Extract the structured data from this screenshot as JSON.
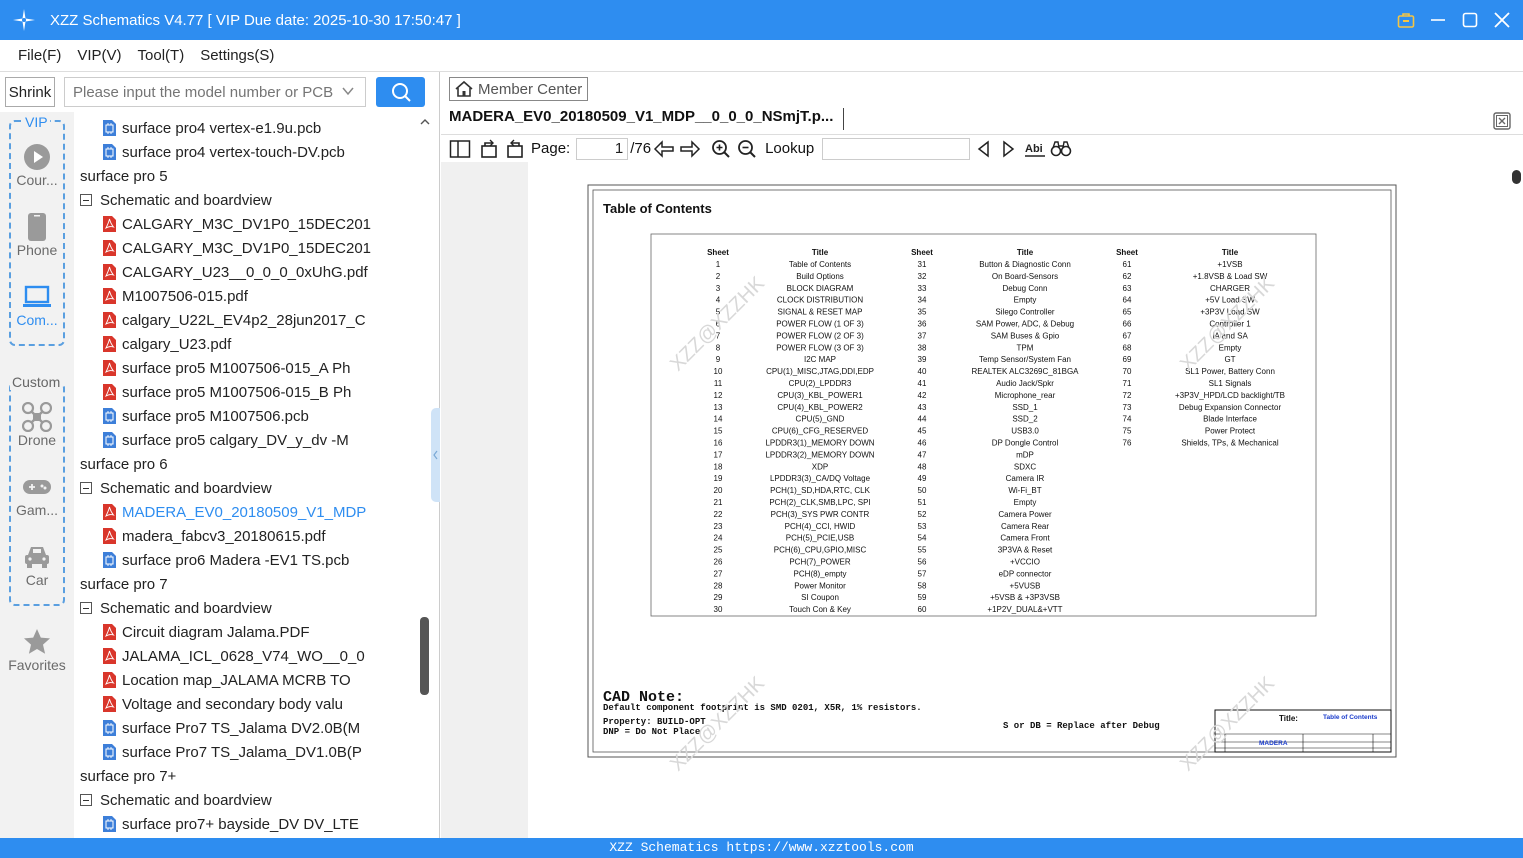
{
  "window": {
    "title": "XZZ Schematics V4.77 [ VIP Due date: 2025-10-30 17:50:47 ]"
  },
  "menu": [
    "File(F)",
    "VIP(V)",
    "Tool(T)",
    "Settings(S)"
  ],
  "toolbar": {
    "shrink": "Shrink",
    "search_placeholder": "Please input the model number or PCB"
  },
  "sidebar": {
    "vip_label": "VIP",
    "custom_label": "Custom",
    "items": [
      {
        "label": "Cour...",
        "icon": "play-icon"
      },
      {
        "label": "Phone",
        "icon": "phone-icon"
      },
      {
        "label": "Com...",
        "icon": "laptop-icon",
        "active": true
      },
      {
        "label": "Drone",
        "icon": "drone-icon"
      },
      {
        "label": "Gam...",
        "icon": "gamepad-icon"
      },
      {
        "label": "Car",
        "icon": "car-icon"
      },
      {
        "label": "Favorites",
        "icon": "star-icon"
      }
    ]
  },
  "tree": [
    {
      "level": 2,
      "type": "pcb",
      "label": "surface pro4 vertex-e1.9u.pcb"
    },
    {
      "level": 2,
      "type": "pcb",
      "label": "surface pro4 vertex-touch-DV.pcb"
    },
    {
      "level": 0,
      "type": "folder",
      "label": "surface pro 5"
    },
    {
      "level": 1,
      "type": "folder",
      "label": "Schematic and boardview"
    },
    {
      "level": 2,
      "type": "pdf",
      "label": "CALGARY_M3C_DV1P0_15DEC201"
    },
    {
      "level": 2,
      "type": "pdf",
      "label": "CALGARY_M3C_DV1P0_15DEC201"
    },
    {
      "level": 2,
      "type": "pdf",
      "label": "CALGARY_U23__0_0_0_0xUhG.pdf"
    },
    {
      "level": 2,
      "type": "pdf",
      "label": "M1007506-015.pdf"
    },
    {
      "level": 2,
      "type": "pdf",
      "label": "calgary_U22L_EV4p2_28jun2017_C"
    },
    {
      "level": 2,
      "type": "pdf",
      "label": "calgary_U23.pdf"
    },
    {
      "level": 2,
      "type": "pdf",
      "label": "surface pro5 M1007506-015_A Ph"
    },
    {
      "level": 2,
      "type": "pdf",
      "label": "surface pro5 M1007506-015_B Ph"
    },
    {
      "level": 2,
      "type": "pcb",
      "label": "surface pro5 M1007506.pcb"
    },
    {
      "level": 2,
      "type": "pcb",
      "label": "surface pro5 calgary_DV_y_dv -M"
    },
    {
      "level": 0,
      "type": "folder",
      "label": "surface pro 6"
    },
    {
      "level": 1,
      "type": "folder",
      "label": "Schematic and boardview"
    },
    {
      "level": 2,
      "type": "pdf",
      "label": "MADERA_EV0_20180509_V1_MDP",
      "selected": true
    },
    {
      "level": 2,
      "type": "pdf",
      "label": "madera_fabcv3_20180615.pdf"
    },
    {
      "level": 2,
      "type": "pcb",
      "label": "surface pro6 Madera -EV1 TS.pcb"
    },
    {
      "level": 0,
      "type": "folder",
      "label": "surface pro 7"
    },
    {
      "level": 1,
      "type": "folder",
      "label": "Schematic and boardview"
    },
    {
      "level": 2,
      "type": "pdf",
      "label": "Circuit diagram Jalama.PDF"
    },
    {
      "level": 2,
      "type": "pdf",
      "label": "JALAMA_ICL_0628_V74_WO__0_0"
    },
    {
      "level": 2,
      "type": "pdf",
      "label": "Location map_JALAMA MCRB TO"
    },
    {
      "level": 2,
      "type": "pdf",
      "label": "Voltage and secondary body valu"
    },
    {
      "level": 2,
      "type": "pcb",
      "label": "surface Pro7 TS_Jalama DV2.0B(M"
    },
    {
      "level": 2,
      "type": "pcb",
      "label": "surface Pro7 TS_Jalama_DV1.0B(P"
    },
    {
      "level": 0,
      "type": "folder",
      "label": "surface pro 7+"
    },
    {
      "level": 1,
      "type": "folder",
      "label": "Schematic and boardview"
    },
    {
      "level": 2,
      "type": "pcb",
      "label": "surface pro7+ bayside_DV DV_LTE"
    }
  ],
  "viewer": {
    "member_center": "Member Center",
    "doc_title": "MADERA_EV0_20180509_V1_MDP__0_0_0_NSmjT.p...",
    "page_label": "Page:",
    "page_current": "1",
    "page_total": "/76",
    "lookup_label": "Lookup"
  },
  "document": {
    "heading": "Table of Contents",
    "col_headers": {
      "sheet": "Sheet",
      "title": "Title"
    },
    "col1": [
      [
        "1",
        "Table of Contents"
      ],
      [
        "2",
        "Build Options"
      ],
      [
        "3",
        "BLOCK DIAGRAM"
      ],
      [
        "4",
        "CLOCK DISTRIBUTION"
      ],
      [
        "5",
        "SIGNAL & RESET MAP"
      ],
      [
        "6",
        "POWER FLOW (1 OF 3)"
      ],
      [
        "7",
        "POWER FLOW (2 OF 3)"
      ],
      [
        "8",
        "POWER FLOW (3 OF 3)"
      ],
      [
        "9",
        "I2C MAP"
      ],
      [
        "10",
        "CPU(1)_MISC,JTAG,DDI,EDP"
      ],
      [
        "11",
        "CPU(2)_LPDDR3"
      ],
      [
        "12",
        "CPU(3)_KBL_POWER1"
      ],
      [
        "13",
        "CPU(4)_KBL_POWER2"
      ],
      [
        "14",
        "CPU(5)_GND"
      ],
      [
        "15",
        "CPU(6)_CFG_RESERVED"
      ],
      [
        "16",
        "LPDDR3(1)_MEMORY DOWN"
      ],
      [
        "17",
        "LPDDR3(2)_MEMORY DOWN"
      ],
      [
        "18",
        "XDP"
      ],
      [
        "19",
        "LPDDR3(3)_CA/DQ Voltage"
      ],
      [
        "20",
        "PCH(1)_SD,HDA,RTC, CLK"
      ],
      [
        "21",
        "PCH(2)_CLK,SMB,LPC, SPI"
      ],
      [
        "22",
        "PCH(3)_SYS PWR CONTR"
      ],
      [
        "23",
        "PCH(4)_CCI, HWID"
      ],
      [
        "24",
        "PCH(5)_PCIE,USB"
      ],
      [
        "25",
        "PCH(6)_CPU,GPIO,MISC"
      ],
      [
        "26",
        "PCH(7)_POWER"
      ],
      [
        "27",
        "PCH(8)_empty"
      ],
      [
        "28",
        "Power Monitor"
      ],
      [
        "29",
        "SI Coupon"
      ],
      [
        "30",
        "Touch Con & Key"
      ]
    ],
    "col2": [
      [
        "31",
        "Button & Diagnostic Conn"
      ],
      [
        "32",
        "On Board-Sensors"
      ],
      [
        "33",
        "Debug Conn"
      ],
      [
        "34",
        "Empty"
      ],
      [
        "35",
        "Silego Controller"
      ],
      [
        "36",
        "SAM Power, ADC, & Debug"
      ],
      [
        "37",
        "SAM Buses & Gpio"
      ],
      [
        "38",
        "TPM"
      ],
      [
        "39",
        "Temp Sensor/System Fan"
      ],
      [
        "40",
        "REALTEK ALC3269C_81BGA"
      ],
      [
        "41",
        "Audio Jack/Spkr"
      ],
      [
        "42",
        "Microphone_rear"
      ],
      [
        "43",
        "SSD_1"
      ],
      [
        "44",
        "SSD_2"
      ],
      [
        "45",
        "USB3.0"
      ],
      [
        "46",
        "DP Dongle Control"
      ],
      [
        "47",
        "mDP"
      ],
      [
        "48",
        "SDXC"
      ],
      [
        "49",
        "Camera IR"
      ],
      [
        "50",
        "Wi-Fi_BT"
      ],
      [
        "51",
        "Empty"
      ],
      [
        "52",
        "Camera Power"
      ],
      [
        "53",
        "Camera Rear"
      ],
      [
        "54",
        "Camera Front"
      ],
      [
        "55",
        "3P3VA & Reset"
      ],
      [
        "56",
        "+VCCIO"
      ],
      [
        "57",
        "eDP connector"
      ],
      [
        "58",
        "+5VUSB"
      ],
      [
        "59",
        "+5VSB & +3P3VSB"
      ],
      [
        "60",
        "+1P2V_DUAL&+VTT"
      ]
    ],
    "col3": [
      [
        "61",
        "+1VSB"
      ],
      [
        "62",
        "+1.8VSB & Load SW"
      ],
      [
        "63",
        "CHARGER"
      ],
      [
        "64",
        "+5V Load SW"
      ],
      [
        "65",
        "+3P3V Load SW"
      ],
      [
        "66",
        "Controller 1"
      ],
      [
        "67",
        "IA and SA"
      ],
      [
        "68",
        "Empty"
      ],
      [
        "69",
        "GT"
      ],
      [
        "70",
        "SL1 Power, Battery Conn"
      ],
      [
        "71",
        "SL1 Signals"
      ],
      [
        "72",
        "+3P3V_HPD/LCD backlight/TB"
      ],
      [
        "73",
        "Debug Expansion Connector"
      ],
      [
        "74",
        "Blade Interface"
      ],
      [
        "75",
        "Power Protect"
      ],
      [
        "76",
        "Shields, TPs, & Mechanical"
      ]
    ],
    "cad_note": "CAD Note:",
    "note1": "Default component footprint is SMD 0201, X5R, 1% resistors.",
    "note2": "Property: BUILD-OPT",
    "note3": "DNP = Do Not Place",
    "note4": "S or DB = Replace after Debug",
    "tb_title_label": "Title:",
    "tb_title": "Table of Contents",
    "tb_project": "MADERA",
    "watermark": "XZZ@XZZHK"
  },
  "statusbar": "XZZ Schematics https://www.xzztools.com"
}
